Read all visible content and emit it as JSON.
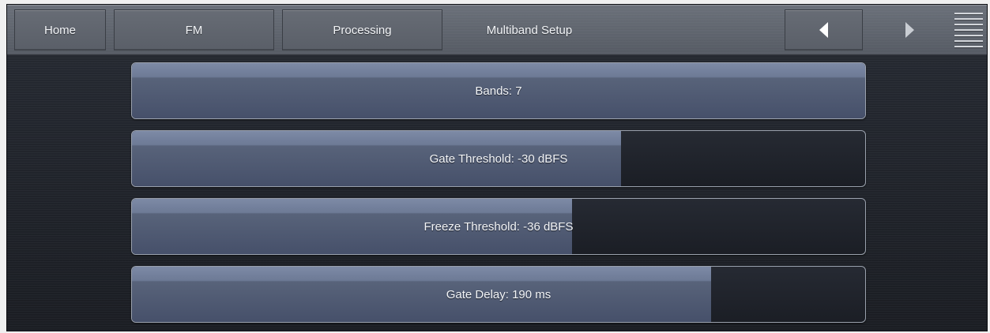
{
  "topbar": {
    "tabs": [
      {
        "label": "Home"
      },
      {
        "label": "FM"
      },
      {
        "label": "Processing"
      }
    ],
    "current_page": "Multiband Setup"
  },
  "params": [
    {
      "label": "Bands: 7",
      "fill_fraction": 1.0
    },
    {
      "label": "Gate Threshold: -30 dBFS",
      "fill_fraction": 0.667
    },
    {
      "label": "Freeze Threshold: -36 dBFS",
      "fill_fraction": 0.6
    },
    {
      "label": "Gate Delay: 190 ms",
      "fill_fraction": 0.79
    }
  ],
  "icons": {
    "back": "left-arrow-icon",
    "forward": "right-arrow-icon",
    "menu": "hamburger-menu-icon"
  },
  "colors": {
    "bar_fill": "#6d7a95",
    "bar_bg": "#1b1e25",
    "topbar": "#5e636c"
  }
}
